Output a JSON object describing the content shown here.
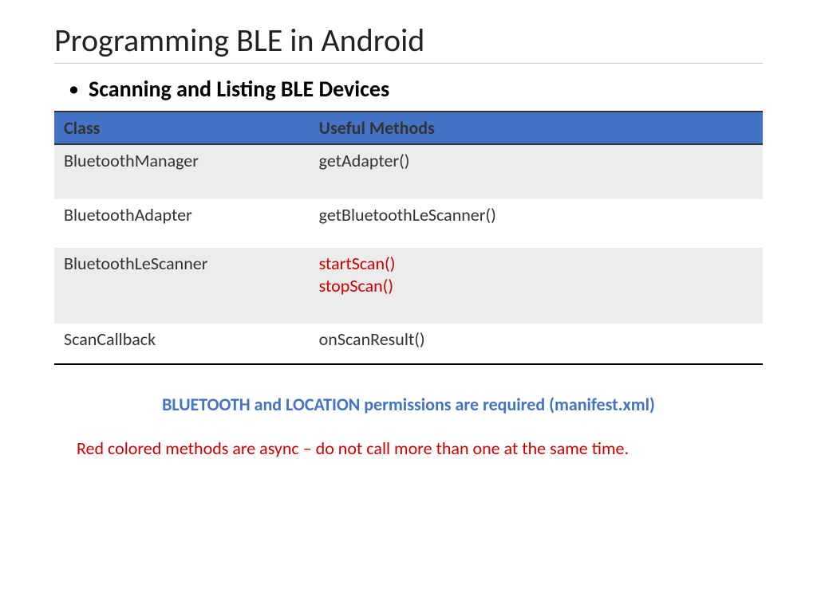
{
  "title": "Programming BLE in Android",
  "subtitle": "Scanning and Listing BLE Devices",
  "table": {
    "headers": {
      "class": "Class",
      "methods": "Useful Methods"
    },
    "rows": [
      {
        "class": "BluetoothManager",
        "methods": [
          {
            "text": "getAdapter()",
            "red": false
          }
        ]
      },
      {
        "class": "BluetoothAdapter",
        "methods": [
          {
            "text": "getBluetoothLeScanner()",
            "red": false
          }
        ]
      },
      {
        "class": "BluetoothLeScanner",
        "methods": [
          {
            "text": "startScan()",
            "red": true
          },
          {
            "text": "stopScan()",
            "red": true
          }
        ]
      },
      {
        "class": "ScanCallback",
        "methods": [
          {
            "text": "onScanResult()",
            "red": false
          }
        ]
      }
    ]
  },
  "notes": {
    "blue": "BLUETOOTH and LOCATION permissions are required (manifest.xml)",
    "red": "Red colored methods are async – do not call more than one at the same time."
  }
}
